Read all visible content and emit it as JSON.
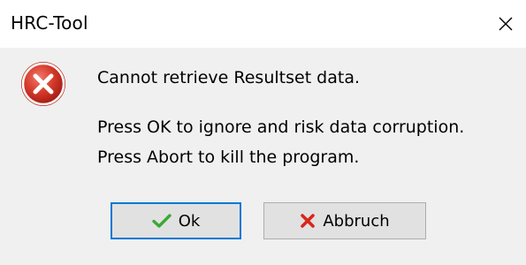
{
  "window": {
    "title": "HRC-Tool",
    "close_icon": "close-icon"
  },
  "dialog": {
    "icon": "error-icon",
    "message_line1": "Cannot retrieve Resultset data.",
    "message_line2": "Press OK to ignore and risk data corruption.",
    "message_line3": "Press Abort to kill the program."
  },
  "buttons": {
    "ok_label": "Ok",
    "ok_icon": "checkmark-icon",
    "abort_label": "Abbruch",
    "abort_icon": "x-mark-icon"
  },
  "colors": {
    "error_red": "#c42b1c",
    "check_green": "#3aa935",
    "focus_border": "#0078d7"
  }
}
